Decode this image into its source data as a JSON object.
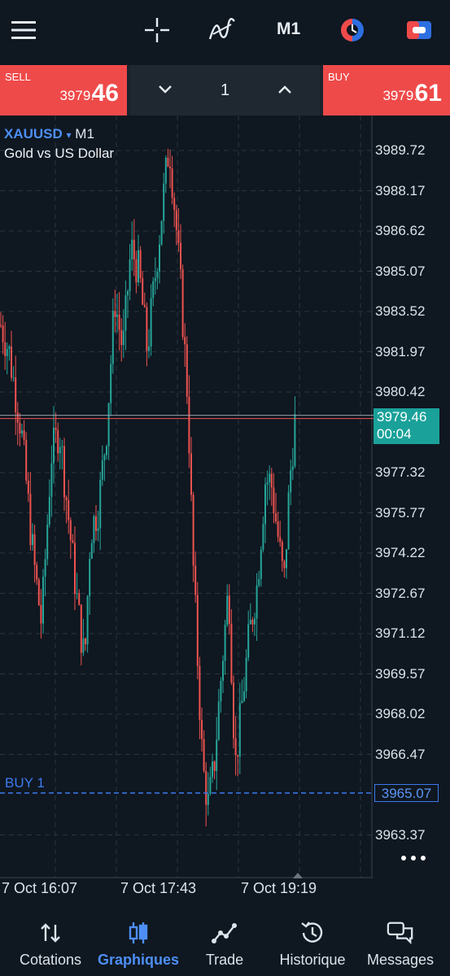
{
  "toolbar": {
    "timeframe": "M1",
    "icons": [
      "menu-icon",
      "crosshair-icon",
      "indicators-icon",
      "timeframe-label",
      "objects-icon",
      "one-click-trading-icon"
    ]
  },
  "trade": {
    "sell": {
      "label": "SELL",
      "price_prefix": "3979.",
      "price_big": "46"
    },
    "buy": {
      "label": "BUY",
      "price_prefix": "3979.",
      "price_big": "61"
    },
    "volume": "1"
  },
  "chart": {
    "symbol": "XAUUSD",
    "symbol_arrow": "▾",
    "timeframe": "M1",
    "description": "Gold vs US Dollar",
    "price_levels": [
      "3989.72",
      "3988.17",
      "3986.62",
      "3985.07",
      "3983.52",
      "3981.97",
      "3980.42",
      "3977.32",
      "3975.77",
      "3974.22",
      "3972.67",
      "3971.12",
      "3969.57",
      "3968.02",
      "3966.47",
      "3963.37"
    ],
    "bid_price": "3979.46",
    "countdown": "00:04",
    "order_label": "BUY 1",
    "order_price": "3965.07",
    "time_labels": [
      "7 Oct 16:07",
      "7 Oct 17:43",
      "7 Oct 19:19"
    ],
    "colors": {
      "bull": "#26a69a",
      "bear": "#ef5350",
      "bid_line": "#ef5350",
      "ask_line": "#ffffff",
      "order_line": "#3b7bf0"
    }
  },
  "nav": {
    "items": [
      {
        "label": "Cotations",
        "icon": "quotes-icon"
      },
      {
        "label": "Graphiques",
        "icon": "charts-icon",
        "active": true
      },
      {
        "label": "Trade",
        "icon": "trade-icon"
      },
      {
        "label": "Historique",
        "icon": "history-icon"
      },
      {
        "label": "Messages",
        "icon": "messages-icon"
      }
    ]
  }
}
